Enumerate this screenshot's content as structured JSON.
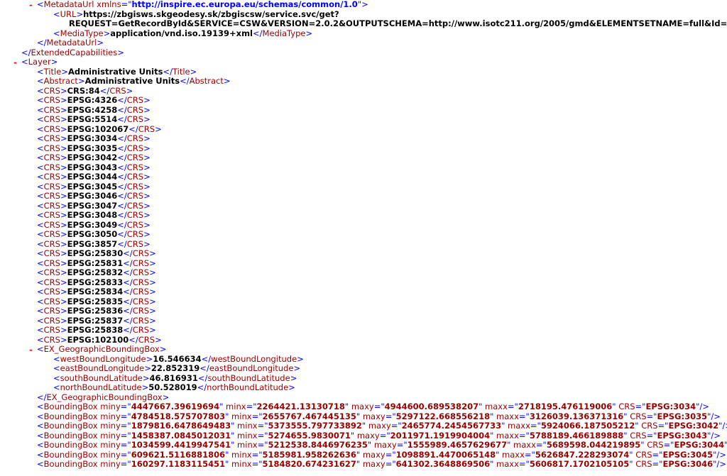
{
  "top": {
    "metadata_url_tag": "MetadataUrl",
    "xmlns_attr": "xmlns",
    "xmlns_value": "http://inspire.ec.europa.eu/schemas/common/1.0",
    "url_tag": "URL",
    "url_line1": "https://zbgisws.skgeodesy.sk/zbgiscsw/service.svc/get?",
    "url_line2": "REQUEST=GetRecordById&SERVICE=CSW&VERSION=2.0.2&OUTPUTSCHEMA=http://www.isotc211.org/2005/gmd&ELEMENTSETNAME=full&Id=",
    "media_type_tag": "MediaType",
    "media_type_value": "application/vnd.iso.19139+xml",
    "extended_capabilities_tag": "ExtendedCapabilities"
  },
  "toggle_glyph": "-",
  "layer": {
    "tag": "Layer",
    "title_tag": "Title",
    "title": "Administrative Units",
    "abstract_tag": "Abstract",
    "abstract": "Administrative Units",
    "crs_tag": "CRS",
    "crs": [
      "CRS:84",
      "EPSG:4326",
      "EPSG:4258",
      "EPSG:5514",
      "EPSG:102067",
      "EPSG:3034",
      "EPSG:3035",
      "EPSG:3042",
      "EPSG:3043",
      "EPSG:3044",
      "EPSG:3045",
      "EPSG:3046",
      "EPSG:3047",
      "EPSG:3048",
      "EPSG:3049",
      "EPSG:3050",
      "EPSG:3857",
      "EPSG:25830",
      "EPSG:25831",
      "EPSG:25832",
      "EPSG:25833",
      "EPSG:25834",
      "EPSG:25835",
      "EPSG:25836",
      "EPSG:25837",
      "EPSG:25838",
      "EPSG:102100"
    ],
    "geo_bbox": {
      "tag": "EX_GeographicBoundingBox",
      "items": [
        {
          "tag": "westBoundLongitude",
          "value": "16.546634"
        },
        {
          "tag": "eastBoundLongitude",
          "value": "22.852319"
        },
        {
          "tag": "southBoundLatitude",
          "value": "46.816931"
        },
        {
          "tag": "northBoundLatitude",
          "value": "50.528019"
        }
      ]
    },
    "bbox_tag": "BoundingBox",
    "bounding_boxes": [
      {
        "miny": "4447667.39619694",
        "minx": "2264421.13130718",
        "maxy": "4944600.689538207",
        "maxx": "2718195.476119006",
        "crs": "EPSG:3034"
      },
      {
        "miny": "4784518.575707803",
        "minx": "2655767.467445135",
        "maxy": "5297122.668556218",
        "maxx": "3126039.136371316",
        "crs": "EPSG:3035"
      },
      {
        "miny": "1879816.6478649483",
        "minx": "5373555.797733892",
        "maxy": "2465774.2454567733",
        "maxx": "5924066.187505212",
        "crs": "EPSG:3042"
      },
      {
        "miny": "1458387.0845012031",
        "minx": "5274655.9830071",
        "maxy": "2011971.1919904004",
        "maxx": "5788189.466189888",
        "crs": "EPSG:3043"
      },
      {
        "miny": "1034599.4419947541",
        "minx": "5212538.8446976235",
        "maxy": "1555989.4657629677",
        "maxx": "5689598.044219895",
        "crs": "EPSG:3044"
      },
      {
        "miny": "609621.5116881806",
        "minx": "5185981.958262636",
        "maxy": "1098891.4470065148",
        "maxx": "5626847.228293074",
        "crs": "EPSG:3045"
      },
      {
        "miny": "160297.1183115451",
        "minx": "5184820.674231627",
        "maxy": "641302.3648869506",
        "maxx": "5606817.1702105105",
        "crs": "EPSG:3046"
      }
    ]
  }
}
